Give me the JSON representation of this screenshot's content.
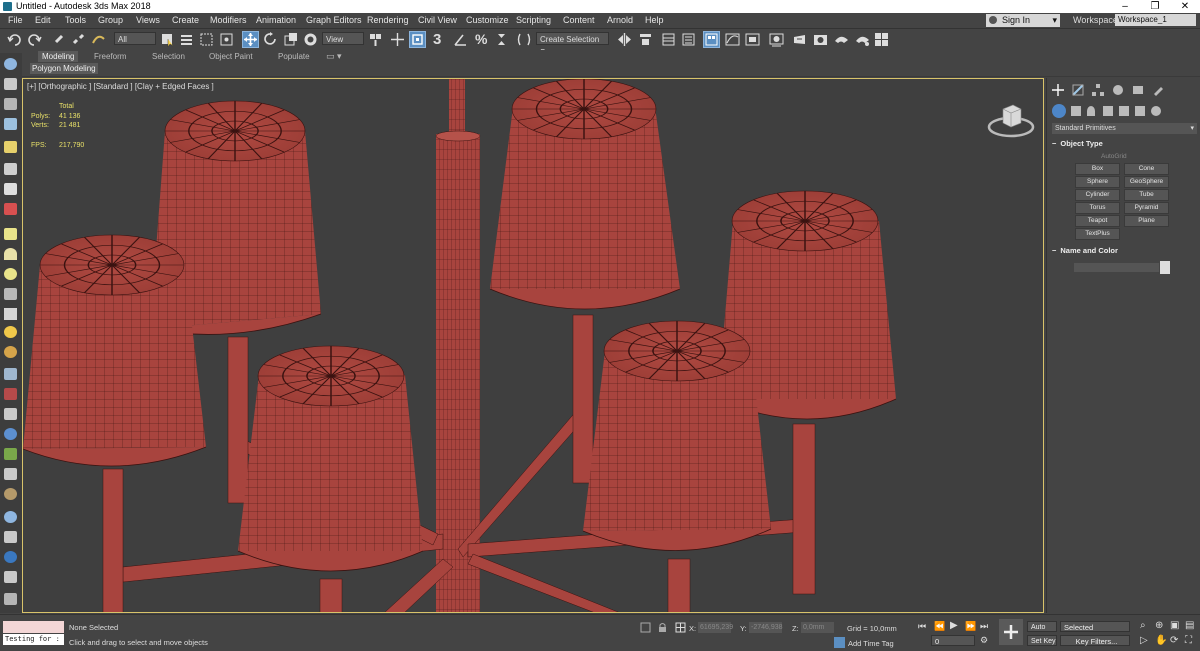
{
  "window": {
    "title": "Untitled - Autodesk 3ds Max 2018",
    "min": "–",
    "max": "❐",
    "close": "✕"
  },
  "menu": [
    "File",
    "Edit",
    "Tools",
    "Group",
    "Views",
    "Create",
    "Modifiers",
    "Animation",
    "Graph Editors",
    "Rendering",
    "Civil View",
    "Customize",
    "Scripting",
    "Content",
    "Arnold",
    "Help"
  ],
  "account": {
    "signin": "Sign In",
    "workspaces_label": "Workspaces:",
    "workspace": "Workspace_1"
  },
  "toolbar": {
    "filter": "All",
    "ref_coord": "View",
    "selection_set": "Create Selection Se",
    "snap_label": "3",
    "angle_snap": "%"
  },
  "ribbon": {
    "tabs": [
      "Modeling",
      "Freeform",
      "Selection",
      "Object Paint",
      "Populate"
    ],
    "active_tab": "Modeling",
    "panel": "Polygon Modeling"
  },
  "viewport": {
    "label": "[+] [Orthographic ] [Standard ] [Clay + Edged Faces ]",
    "stats": {
      "total": "Total",
      "polys_label": "Polys:",
      "polys": "41 136",
      "verts_label": "Verts:",
      "verts": "21 481",
      "fps_label": "FPS:",
      "fps": "217,790"
    }
  },
  "command_panel": {
    "category": "Standard Primitives",
    "object_type": "Object Type",
    "autogrid": "AutoGrid",
    "buttons": [
      "Box",
      "Cone",
      "Sphere",
      "GeoSphere",
      "Cylinder",
      "Tube",
      "Torus",
      "Pyramid",
      "Teapot",
      "Plane",
      "TextPlus"
    ],
    "name_and_color": "Name and Color"
  },
  "status": {
    "maxscript": "Testing for :",
    "selection": "None Selected",
    "prompt": "Click and drag to select and move objects",
    "x_label": "X:",
    "x": "61695,239",
    "y_label": "Y:",
    "y": "-2746,938",
    "z_label": "Z:",
    "z": "0,0mm",
    "grid": "Grid = 10,0mm",
    "add_time_tag": "Add Time Tag",
    "frame": "0",
    "auto_key": "Auto Key",
    "selected": "Selected",
    "set_key": "Set Key",
    "key_filters": "Key Filters..."
  },
  "colors": {
    "shade": "#a8443e",
    "wire": "#3a1210",
    "viewport_border": "#d8c36a",
    "stats": "#e8e069",
    "active_tool": "#5b8fc2"
  }
}
